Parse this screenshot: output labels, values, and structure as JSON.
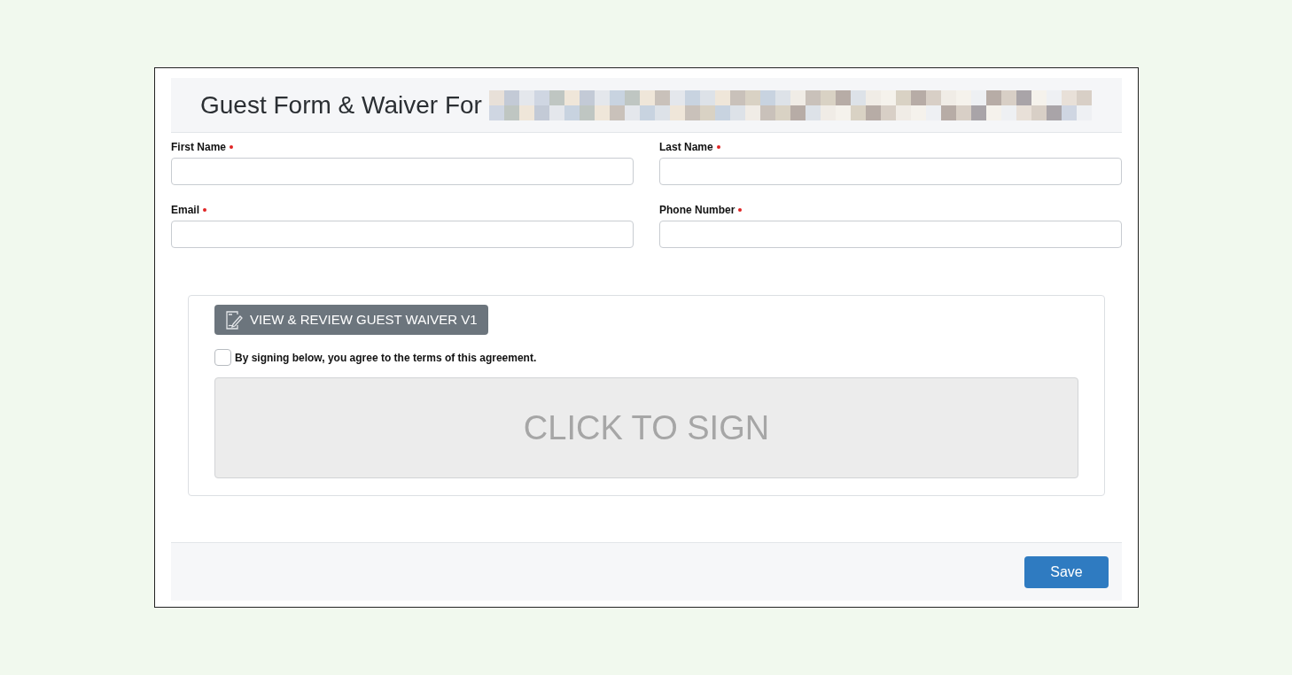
{
  "header": {
    "title": "Guest Form & Waiver For"
  },
  "fields": [
    {
      "label": "First Name",
      "required": true
    },
    {
      "label": "Last Name",
      "required": true
    },
    {
      "label": "Email",
      "required": true
    },
    {
      "label": "Phone Number",
      "required": true
    }
  ],
  "waiver": {
    "button": "VIEW & REVIEW GUEST WAIVER V1",
    "agreement": {
      "label": "By signing below, you agree to the terms of this agreement.",
      "checked": false
    },
    "signature": "CLICK TO SIGN"
  },
  "footer": {
    "button": "Save"
  }
}
